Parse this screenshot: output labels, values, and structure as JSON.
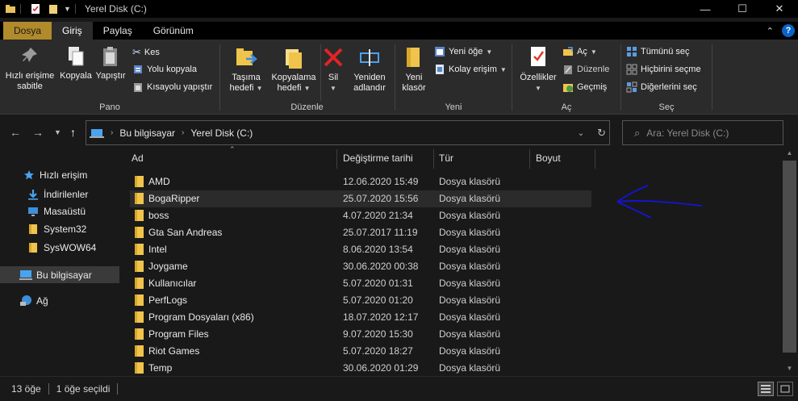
{
  "window": {
    "title": "Yerel Disk (C:)"
  },
  "ribbon_tabs": [
    "Dosya",
    "Giriş",
    "Paylaş",
    "Görünüm"
  ],
  "ribbon": {
    "pano": {
      "label": "Pano",
      "pin": "Hızlı erişime sabitle",
      "copy": "Kopyala",
      "paste": "Yapıştır",
      "cut": "Kes",
      "copy_path": "Yolu kopyala",
      "paste_shortcut": "Kısayolu yapıştır"
    },
    "duzenle": {
      "label": "Düzenle",
      "move_to_1": "Taşıma",
      "move_to_2": "hedefi",
      "copy_to_1": "Kopyalama",
      "copy_to_2": "hedefi",
      "delete": "Sil",
      "rename_1": "Yeniden",
      "rename_2": "adlandır"
    },
    "yeni": {
      "label": "Yeni",
      "new_folder_1": "Yeni",
      "new_folder_2": "klasör",
      "new_item": "Yeni öğe",
      "easy_access": "Kolay erişim"
    },
    "ac": {
      "label": "Aç",
      "properties": "Özellikler",
      "open": "Aç",
      "edit": "Düzenle",
      "history": "Geçmiş"
    },
    "sec": {
      "label": "Seç",
      "select_all": "Tümünü seç",
      "select_none": "Hiçbirini seçme",
      "invert": "Diğerlerini seç"
    }
  },
  "address": {
    "crumbs": [
      "Bu bilgisayar",
      "Yerel Disk (C:)"
    ],
    "search_placeholder": "Ara: Yerel Disk (C:)"
  },
  "sidebar": [
    {
      "label": "Hızlı erişim",
      "icon": "star-icon"
    },
    {
      "label": "İndirilenler",
      "icon": "download-icon"
    },
    {
      "label": "Masaüstü",
      "icon": "desktop-icon"
    },
    {
      "label": "System32",
      "icon": "folder-icon"
    },
    {
      "label": "SysWOW64",
      "icon": "folder-icon"
    },
    {
      "label": "Bu bilgisayar",
      "icon": "computer-icon",
      "selected": true
    },
    {
      "label": "Ağ",
      "icon": "network-icon"
    }
  ],
  "columns": [
    "Ad",
    "Değiştirme tarihi",
    "Tür",
    "Boyut"
  ],
  "files": [
    {
      "name": "AMD",
      "date": "12.06.2020 15:49",
      "type": "Dosya klasörü"
    },
    {
      "name": "BogaRipper",
      "date": "25.07.2020 15:56",
      "type": "Dosya klasörü",
      "hover": true
    },
    {
      "name": "boss",
      "date": "4.07.2020 21:34",
      "type": "Dosya klasörü"
    },
    {
      "name": "Gta San Andreas",
      "date": "25.07.2017 11:19",
      "type": "Dosya klasörü"
    },
    {
      "name": "Intel",
      "date": "8.06.2020 13:54",
      "type": "Dosya klasörü"
    },
    {
      "name": "Joygame",
      "date": "30.06.2020 00:38",
      "type": "Dosya klasörü"
    },
    {
      "name": "Kullanıcılar",
      "date": "5.07.2020 01:31",
      "type": "Dosya klasörü"
    },
    {
      "name": "PerfLogs",
      "date": "5.07.2020 01:20",
      "type": "Dosya klasörü"
    },
    {
      "name": "Program Dosyaları (x86)",
      "date": "18.07.2020 12:17",
      "type": "Dosya klasörü"
    },
    {
      "name": "Program Files",
      "date": "9.07.2020 15:30",
      "type": "Dosya klasörü"
    },
    {
      "name": "Riot Games",
      "date": "5.07.2020 18:27",
      "type": "Dosya klasörü"
    },
    {
      "name": "Temp",
      "date": "30.06.2020 01:29",
      "type": "Dosya klasörü"
    }
  ],
  "status": {
    "count": "13 öğe",
    "selected": "1 öğe seçildi"
  },
  "colors": {
    "file_tab": "#b08a2b",
    "annotation_arrow": "#1414d8",
    "help": "#0a64c8"
  }
}
